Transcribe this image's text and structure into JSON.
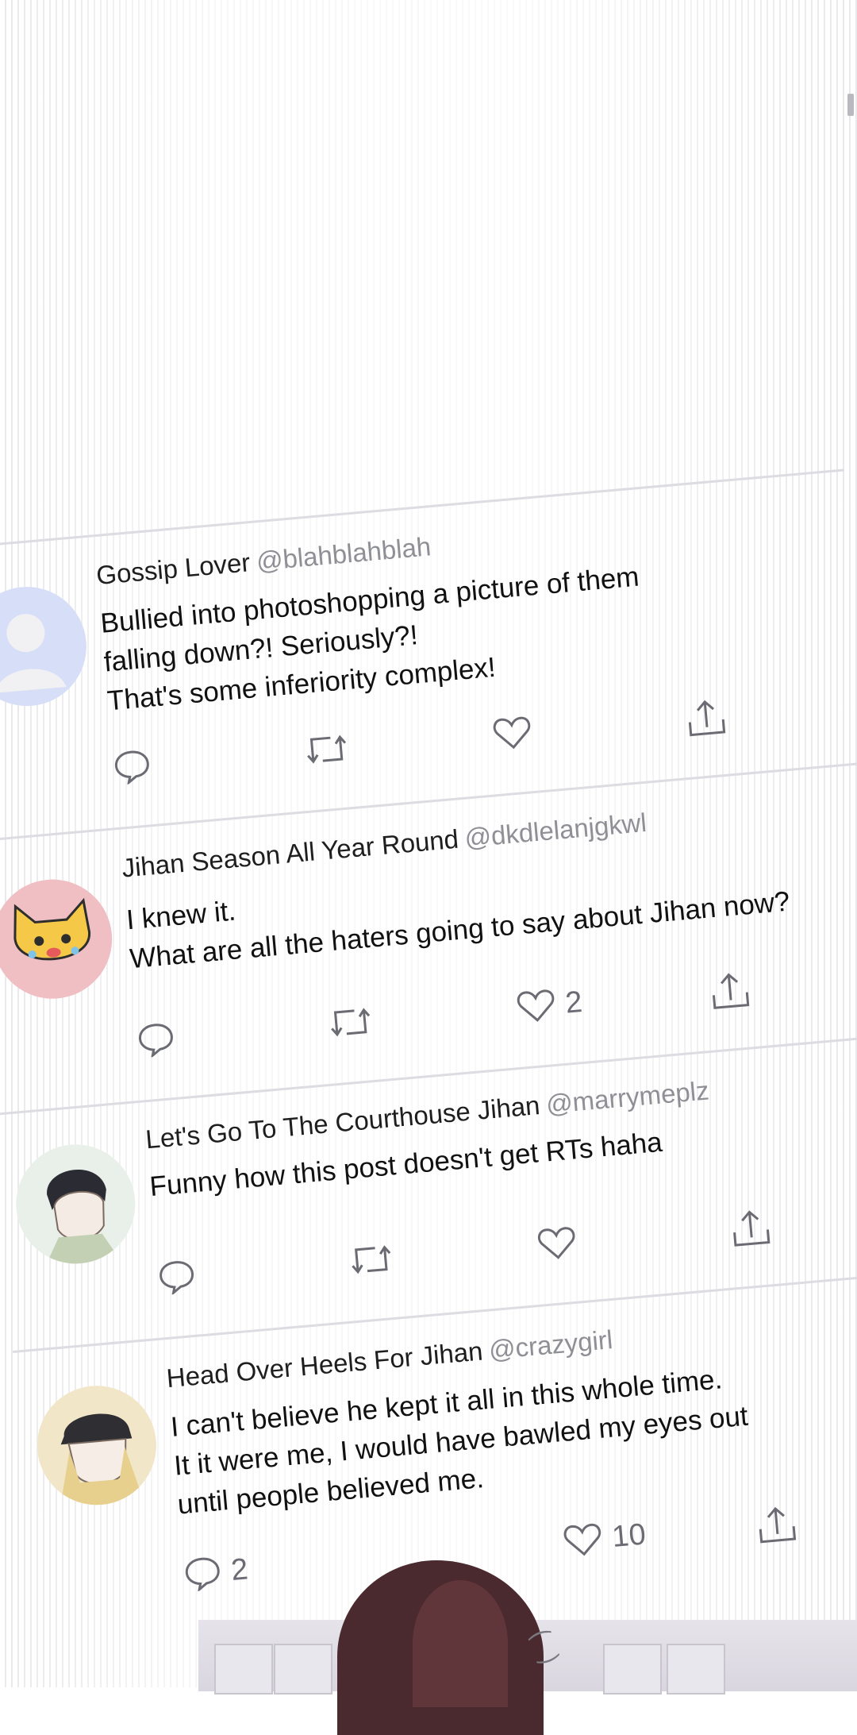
{
  "posts": [
    {
      "display_name": "Gossip Lover",
      "handle": "@blahblahblah",
      "avatar": "default-user-avatar",
      "lines": [
        "Bullied into photoshopping a picture of them",
        "falling down?! Seriously?!",
        "That's some inferiority complex!"
      ],
      "reply_count": "",
      "like_count": ""
    },
    {
      "display_name": "Jihan Season All Year Round",
      "handle": "@dkdlelanjgkwl",
      "avatar": "yellow-cat-avatar",
      "lines": [
        "I knew it.",
        "What are all the haters going to say about Jihan now?"
      ],
      "reply_count": "",
      "like_count": "2"
    },
    {
      "display_name": "Let's Go To The Courthouse Jihan",
      "handle": "@marrymeplz",
      "avatar": "dark-haired-man-avatar",
      "lines": [
        "Funny how this post doesn't get RTs haha"
      ],
      "reply_count": "",
      "like_count": ""
    },
    {
      "display_name": "Head Over Heels For Jihan",
      "handle": "@crazygirl",
      "avatar": "man-with-cap-avatar",
      "lines": [
        "I can't believe he kept it all in this whole time.",
        "It it were me, I would have bawled my eyes out",
        "until people believed me."
      ],
      "reply_count": "2",
      "like_count": "10"
    }
  ],
  "colors": {
    "background": "#ffffff",
    "divider": "#dcdce2",
    "handle_text": "#8f8f96",
    "icon": "#6b6b73",
    "hair": "#4a2a2e"
  },
  "icons": [
    "reply-icon",
    "retweet-icon",
    "like-icon",
    "share-icon"
  ]
}
